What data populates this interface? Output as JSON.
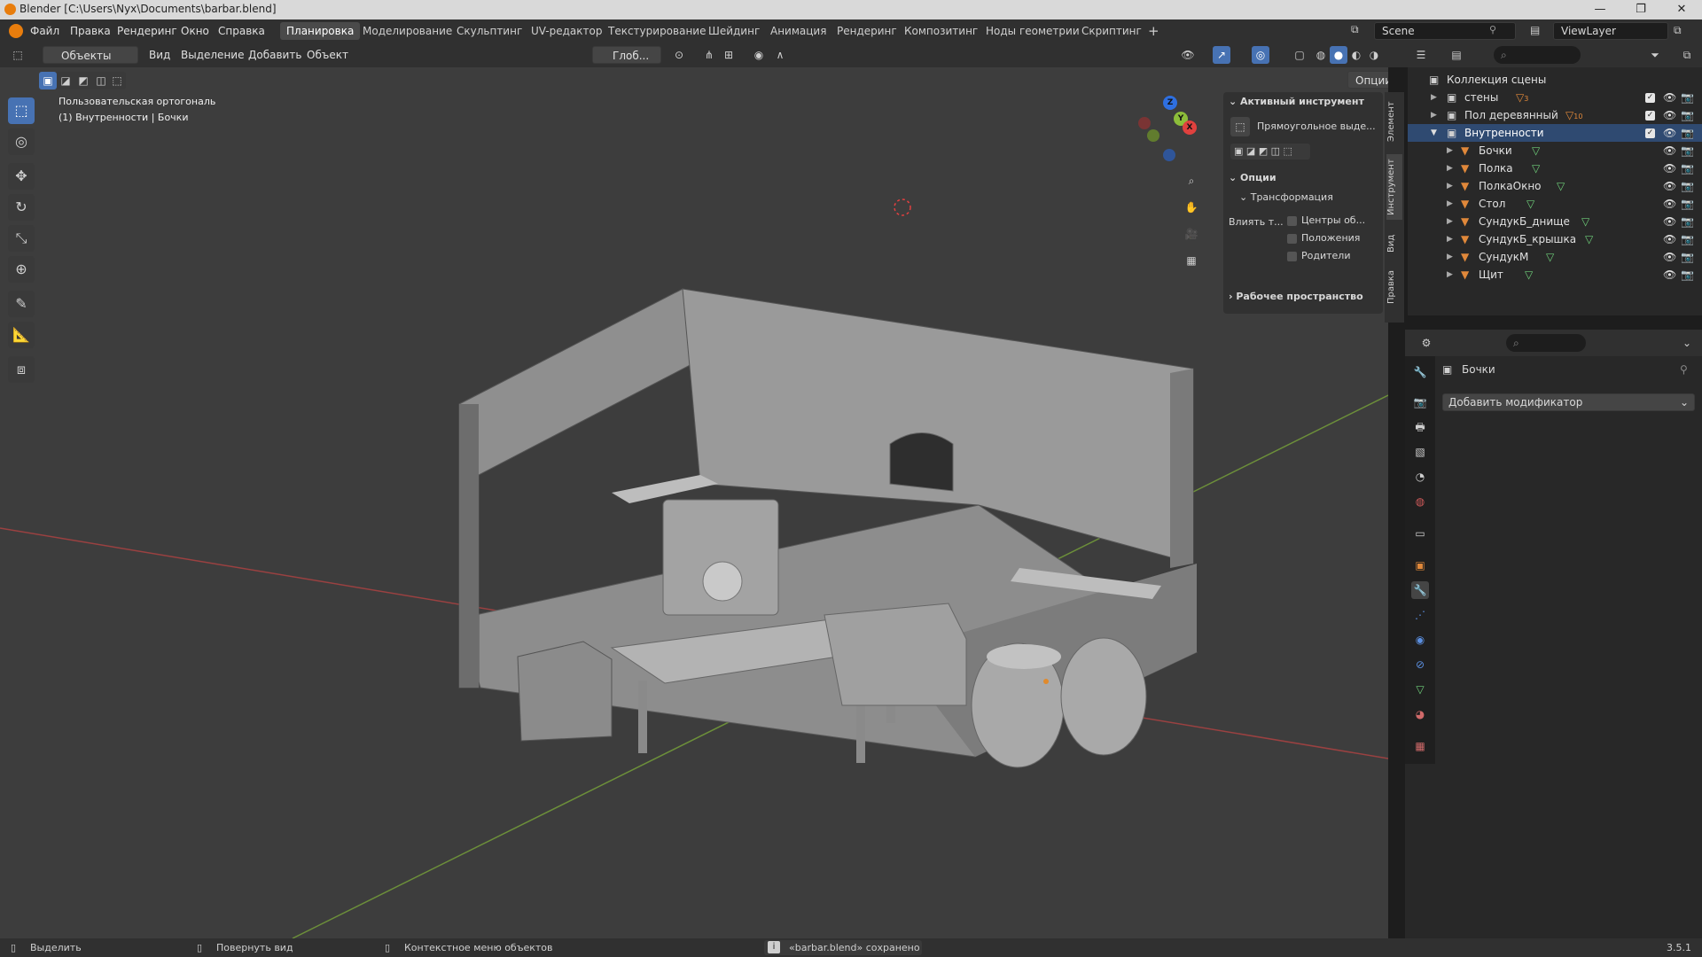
{
  "window": {
    "title": "Blender [C:\\Users\\Nyx\\Documents\\barbar.blend]",
    "minimize": "—",
    "maximize": "❐",
    "close": "✕"
  },
  "menu": [
    "Файл",
    "Правка",
    "Рендеринг",
    "Окно",
    "Справка"
  ],
  "workspaces": [
    "Планировка",
    "Моделирование",
    "Скульптинг",
    "UV-редактор",
    "Текстурирование",
    "Шейдинг",
    "Анимация",
    "Рендеринг",
    "Композитинг",
    "Ноды геометрии",
    "Скриптинг"
  ],
  "workspace_add": "+",
  "scene": {
    "name": "Scene",
    "view_layer": "ViewLayer"
  },
  "viewport_header": {
    "mode": "Объекты",
    "items": [
      "Вид",
      "Выделение",
      "Добавить",
      "Объект"
    ],
    "orientation": "Глоб...",
    "options": "Опции"
  },
  "viewport": {
    "view_name": "Пользовательская ортогональ",
    "object_info": "(1) Внутренности | Бочки"
  },
  "gizmo": {
    "x": "X",
    "y": "Y",
    "z": "Z"
  },
  "npanel": {
    "active_tool_title": "Активный инструмент",
    "tool_name": "Прямоугольное выде...",
    "options_title": "Опции",
    "transform_title": "Трансформация",
    "affect_label": "Влиять т...",
    "affect_options": [
      "Центры об...",
      "Положения",
      "Родители"
    ],
    "workspace_title": "Рабочее пространство",
    "tabs": [
      "Элемент",
      "Инструмент",
      "Вид",
      "Правка"
    ]
  },
  "outliner": {
    "root": "Коллекция сцены",
    "collections": [
      {
        "name": "стены",
        "badge": "3"
      },
      {
        "name": "Пол деревянный",
        "badge": "10"
      },
      {
        "name": "Внутренности",
        "selected": true
      }
    ],
    "objects": [
      "Бочки",
      "Полка",
      "ПолкаОкно",
      "Стол",
      "СундукБ_днище",
      "СундукБ_крышка",
      "СундукМ",
      "Щит"
    ]
  },
  "properties": {
    "object_name": "Бочки",
    "add_modifier": "Добавить модификатор"
  },
  "status": {
    "select": "Выделить",
    "rotate": "Повернуть вид",
    "context_menu": "Контекстное меню объектов",
    "message": "«barbar.blend» сохранено",
    "version": "3.5.1"
  },
  "colors": {
    "accent": "#4772b3",
    "viewport_bg": "#3d3d3d",
    "panel_bg": "#303030",
    "outliner_bg": "#282828",
    "selection": "#2f4a71",
    "object_icon": "#e0883a",
    "mesh_icon": "#6fcf7a"
  }
}
